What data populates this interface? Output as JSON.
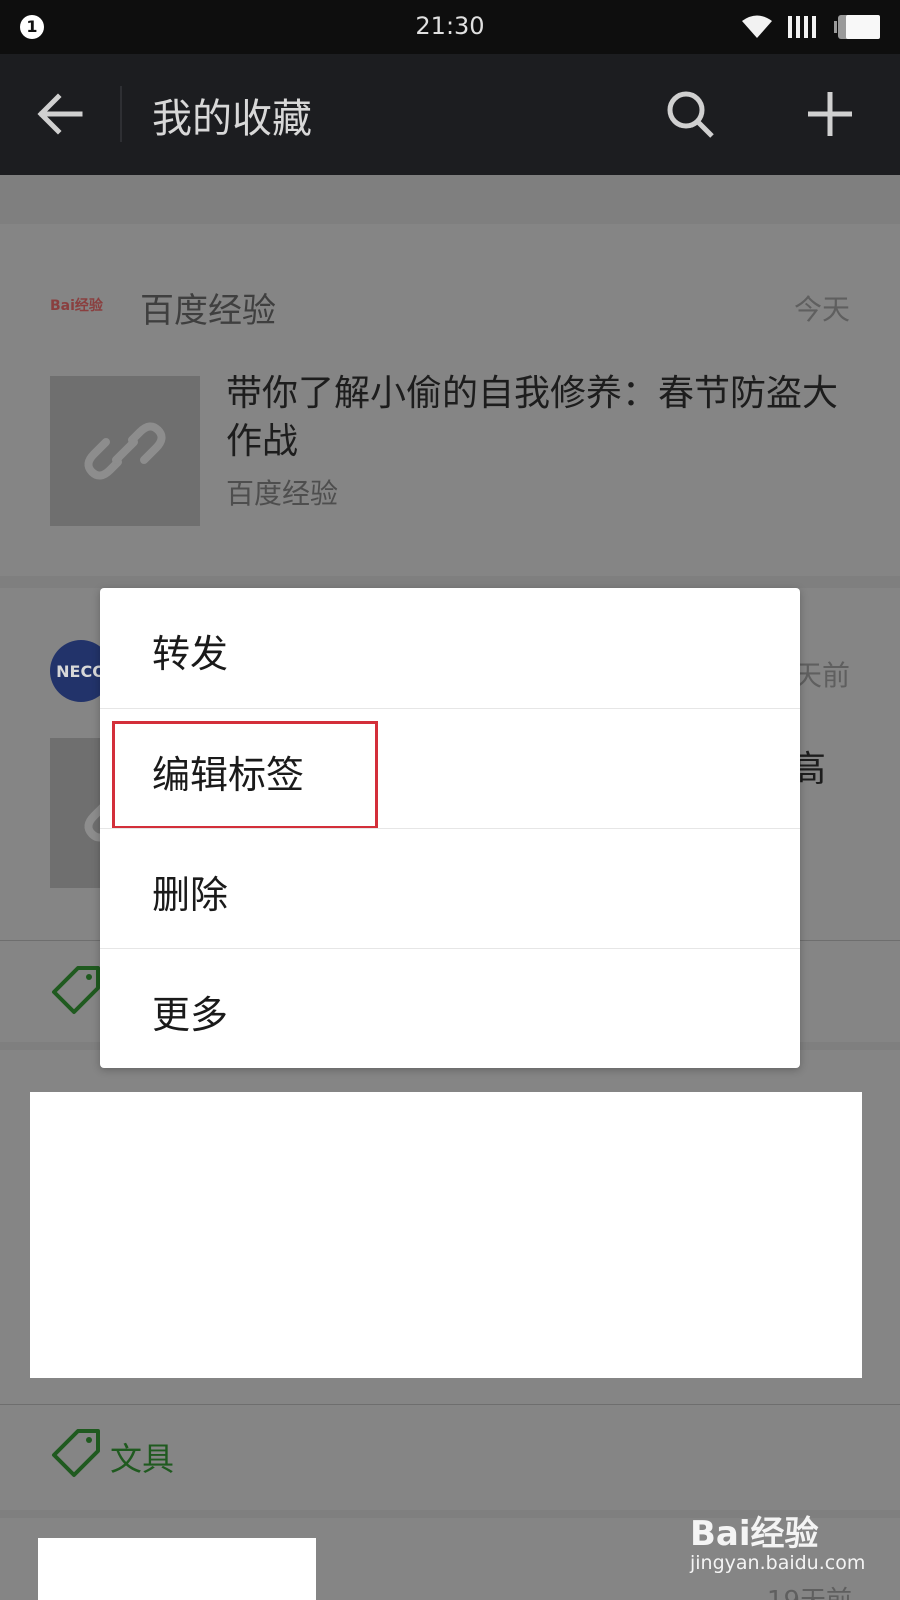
{
  "status_bar": {
    "notification_badge": "1",
    "time": "21:30",
    "icons": [
      "wifi-icon",
      "signal-icon",
      "battery-icon"
    ]
  },
  "header": {
    "title": "我的收藏",
    "icons": [
      "back-arrow-icon",
      "search-icon",
      "plus-icon"
    ]
  },
  "favorites": [
    {
      "source": "百度经验",
      "source_logo_text": "Bai经验",
      "time": "今天",
      "title": "带你了解小偷的自我修养：春节防盗大作战",
      "subtitle": "百度经验",
      "thumb_icon": "link-icon"
    },
    {
      "avatar_text": "NECO",
      "time_partial": "天前",
      "title_partial": "高",
      "thumb_icon": "link-icon"
    },
    {
      "tag": "文具",
      "tag_icon": "tag-icon"
    },
    {
      "time_partial": "19天前"
    }
  ],
  "context_menu": {
    "items": [
      "转发",
      "编辑标签",
      "删除",
      "更多"
    ],
    "highlighted_index": 1,
    "highlight_color": "#d32f3a"
  },
  "watermark": {
    "logo": "Bai经验",
    "url": "jingyan.baidu.com"
  },
  "colors": {
    "action_bar": "#1c1d20",
    "status_bar": "#0e0e0e",
    "tag_green": "#1f5a1f"
  }
}
